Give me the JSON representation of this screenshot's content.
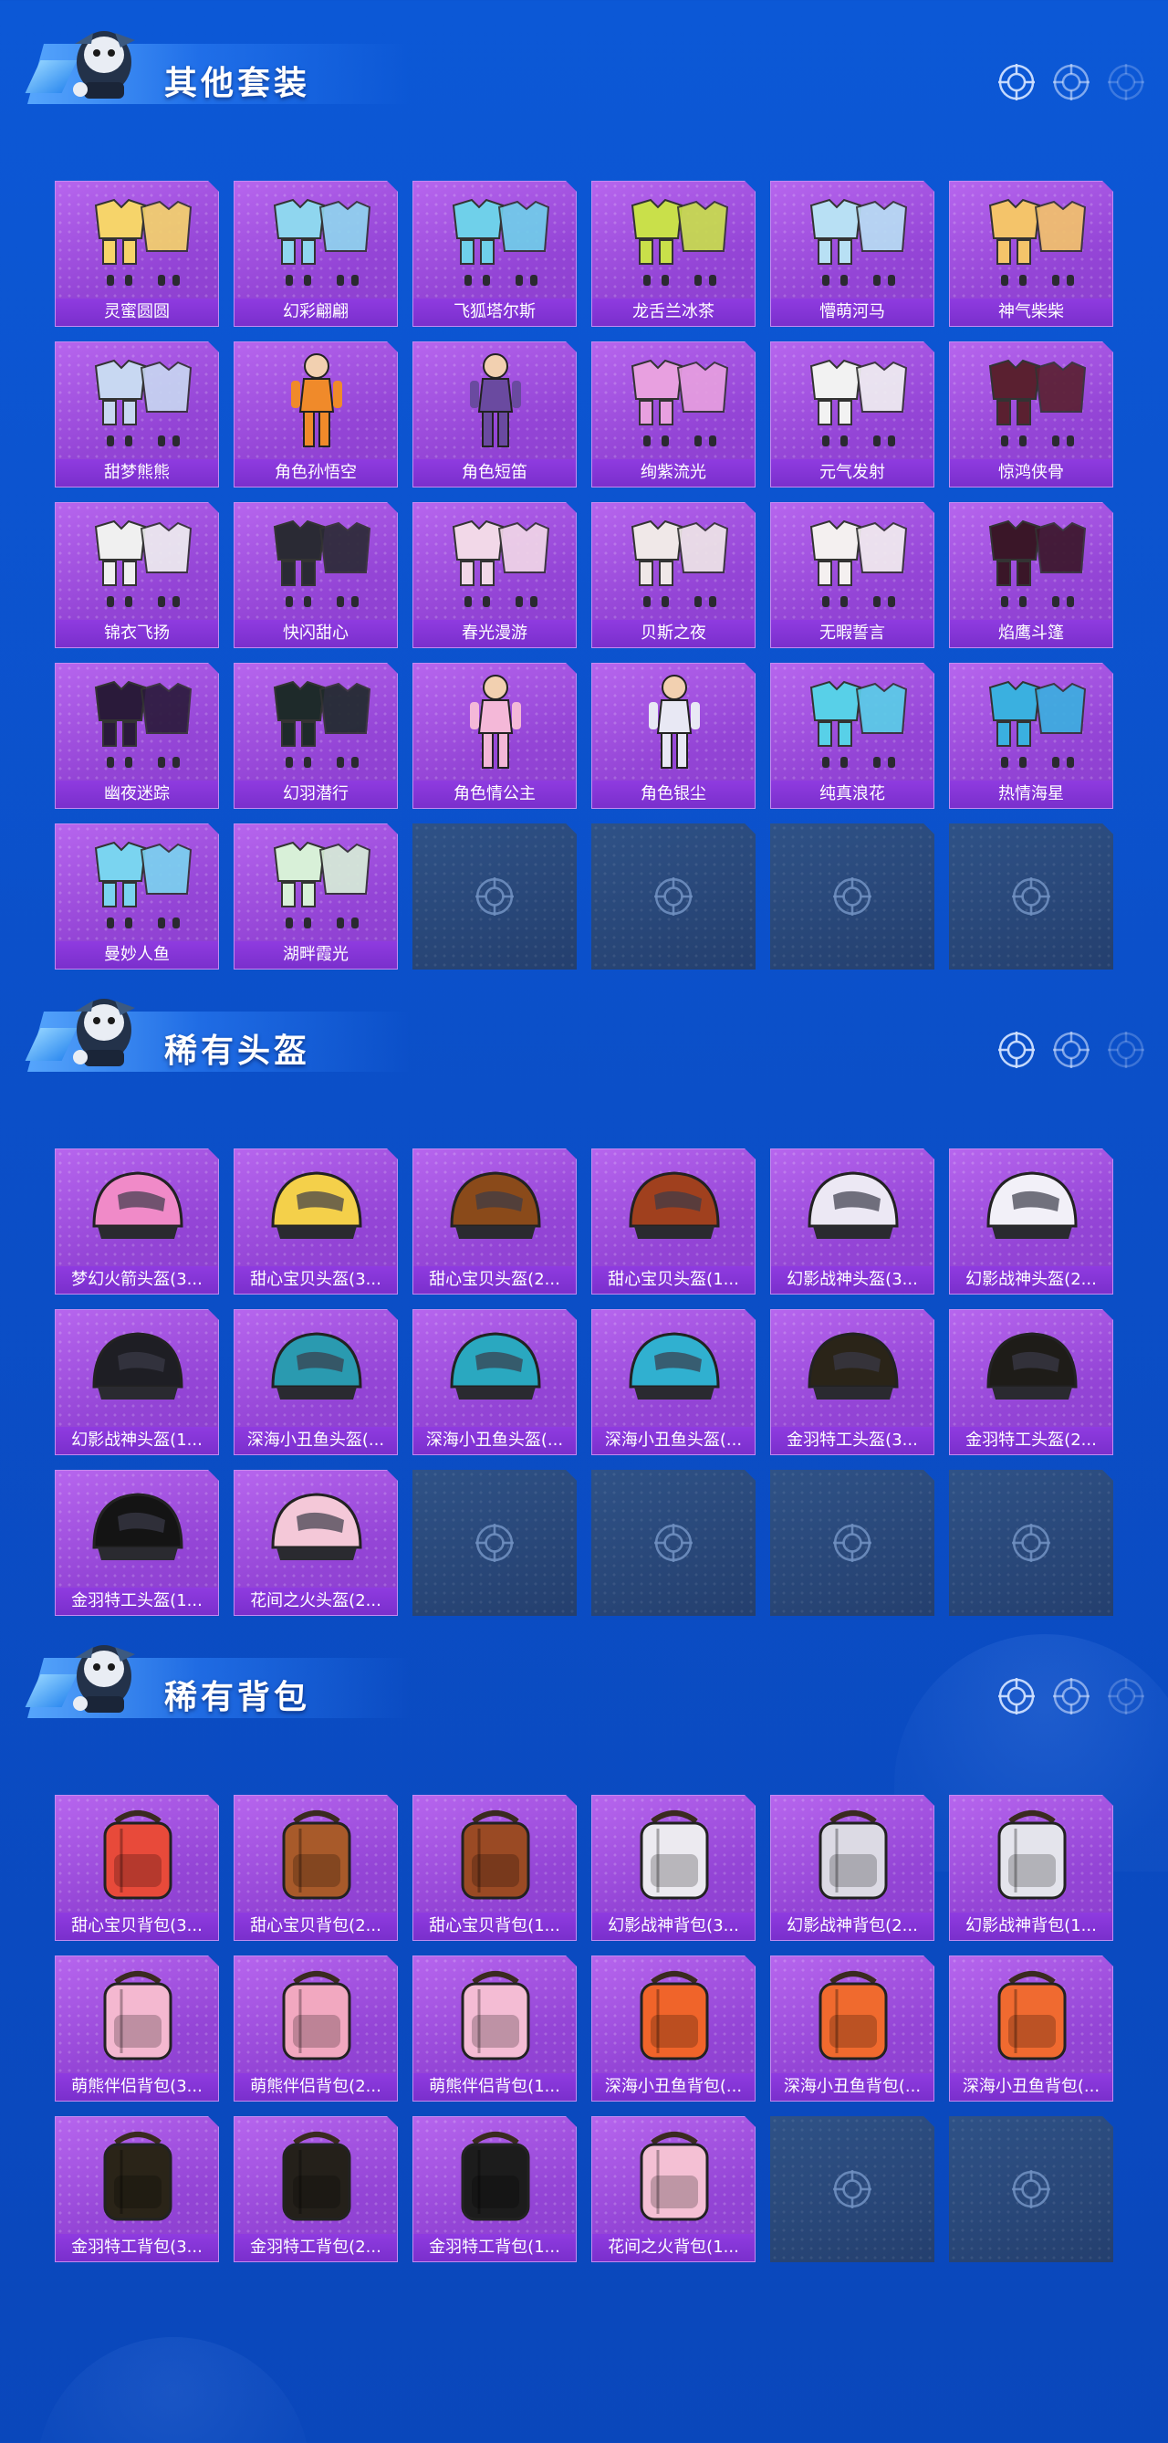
{
  "sections": [
    {
      "title": "其他套装",
      "items": [
        {
          "label": "灵蜜圆圆",
          "icon": "outfit-icon",
          "accent": "#f6d46a"
        },
        {
          "label": "幻彩翩翩",
          "icon": "outfit-icon",
          "accent": "#8fd6ef"
        },
        {
          "label": "飞狐塔尔斯",
          "icon": "outfit-icon",
          "accent": "#6fd0ea"
        },
        {
          "label": "龙舌兰冰茶",
          "icon": "outfit-icon",
          "accent": "#c9e04a"
        },
        {
          "label": "懵萌河马",
          "icon": "outfit-icon",
          "accent": "#b8e0f4"
        },
        {
          "label": "神气柴柴",
          "icon": "outfit-icon",
          "accent": "#f4c46a"
        },
        {
          "label": "甜梦熊熊",
          "icon": "outfit-icon",
          "accent": "#c8d8f2"
        },
        {
          "label": "角色孙悟空",
          "icon": "character-icon",
          "accent": "#f08a2a"
        },
        {
          "label": "角色短笛",
          "icon": "character-icon",
          "accent": "#6a4aa0"
        },
        {
          "label": "绚紫流光",
          "icon": "outfit-icon",
          "accent": "#e8a0e0"
        },
        {
          "label": "元气发射",
          "icon": "outfit-icon",
          "accent": "#f2f2f2"
        },
        {
          "label": "惊鸿侠骨",
          "icon": "outfit-icon",
          "accent": "#5a2030"
        },
        {
          "label": "锦衣飞扬",
          "icon": "outfit-icon",
          "accent": "#f0f0f0"
        },
        {
          "label": "快闪甜心",
          "icon": "outfit-icon",
          "accent": "#2a2a34"
        },
        {
          "label": "春光漫游",
          "icon": "outfit-icon",
          "accent": "#f2d8e8"
        },
        {
          "label": "贝斯之夜",
          "icon": "outfit-icon",
          "accent": "#f0e8e8"
        },
        {
          "label": "无暇誓言",
          "icon": "outfit-icon",
          "accent": "#f4f0f0"
        },
        {
          "label": "焰鹰斗篷",
          "icon": "outfit-icon",
          "accent": "#3a1628"
        },
        {
          "label": "幽夜迷踪",
          "icon": "outfit-icon",
          "accent": "#2a1a3a"
        },
        {
          "label": "幻羽潜行",
          "icon": "outfit-icon",
          "accent": "#1e2a2a"
        },
        {
          "label": "角色情公主",
          "icon": "character-icon",
          "accent": "#f4b8d8"
        },
        {
          "label": "角色银尘",
          "icon": "character-icon",
          "accent": "#e8e8f4"
        },
        {
          "label": "纯真浪花",
          "icon": "outfit-icon",
          "accent": "#58d0e8"
        },
        {
          "label": "热情海星",
          "icon": "outfit-icon",
          "accent": "#3ab0e0"
        },
        {
          "label": "曼妙人鱼",
          "icon": "outfit-icon",
          "accent": "#7ad4f0"
        },
        {
          "label": "湖畔霞光",
          "icon": "outfit-icon",
          "accent": "#d8f0d8"
        }
      ],
      "empty_slots": 4
    },
    {
      "title": "稀有头盔",
      "items": [
        {
          "label": "梦幻火箭头盔(3...",
          "icon": "helmet-icon",
          "accent": "#f08ac8"
        },
        {
          "label": "甜心宝贝头盔(3...",
          "icon": "helmet-icon",
          "accent": "#f4d04a"
        },
        {
          "label": "甜心宝贝头盔(2...",
          "icon": "helmet-icon",
          "accent": "#8a4a1a"
        },
        {
          "label": "甜心宝贝头盔(1...",
          "icon": "helmet-icon",
          "accent": "#a0401e"
        },
        {
          "label": "幻影战神头盔(3...",
          "icon": "helmet-icon",
          "accent": "#ece8f4"
        },
        {
          "label": "幻影战神头盔(2...",
          "icon": "helmet-icon",
          "accent": "#f2f0f8"
        },
        {
          "label": "幻影战神头盔(1...",
          "icon": "helmet-icon",
          "accent": "#1e1e24"
        },
        {
          "label": "深海小丑鱼头盔(...",
          "icon": "helmet-icon",
          "accent": "#2a9ab0"
        },
        {
          "label": "深海小丑鱼头盔(...",
          "icon": "helmet-icon",
          "accent": "#2aa8c0"
        },
        {
          "label": "深海小丑鱼头盔(...",
          "icon": "helmet-icon",
          "accent": "#30b0d0"
        },
        {
          "label": "金羽特工头盔(3...",
          "icon": "helmet-icon",
          "accent": "#2a2418"
        },
        {
          "label": "金羽特工头盔(2...",
          "icon": "helmet-icon",
          "accent": "#1e1c18"
        },
        {
          "label": "金羽特工头盔(1...",
          "icon": "helmet-icon",
          "accent": "#141414"
        },
        {
          "label": "花间之火头盔(2...",
          "icon": "helmet-icon",
          "accent": "#f4c8d8"
        }
      ],
      "empty_slots": 4
    },
    {
      "title": "稀有背包",
      "items": [
        {
          "label": "甜心宝贝背包(3...",
          "icon": "backpack-icon",
          "accent": "#e84a3a"
        },
        {
          "label": "甜心宝贝背包(2...",
          "icon": "backpack-icon",
          "accent": "#a85a2a"
        },
        {
          "label": "甜心宝贝背包(1...",
          "icon": "backpack-icon",
          "accent": "#9a4a24"
        },
        {
          "label": "幻影战神背包(3...",
          "icon": "backpack-icon",
          "accent": "#eceaf0"
        },
        {
          "label": "幻影战神背包(2...",
          "icon": "backpack-icon",
          "accent": "#dcdae4"
        },
        {
          "label": "幻影战神背包(1...",
          "icon": "backpack-icon",
          "accent": "#e4e4ec"
        },
        {
          "label": "萌熊伴侣背包(3...",
          "icon": "backpack-icon",
          "accent": "#f4b8d0"
        },
        {
          "label": "萌熊伴侣背包(2...",
          "icon": "backpack-icon",
          "accent": "#f2a8c0"
        },
        {
          "label": "萌熊伴侣背包(1...",
          "icon": "backpack-icon",
          "accent": "#f4bcd4"
        },
        {
          "label": "深海小丑鱼背包(...",
          "icon": "backpack-icon",
          "accent": "#f0642a"
        },
        {
          "label": "深海小丑鱼背包(...",
          "icon": "backpack-icon",
          "accent": "#f06a2e"
        },
        {
          "label": "深海小丑鱼背包(...",
          "icon": "backpack-icon",
          "accent": "#f06a30"
        },
        {
          "label": "金羽特工背包(3...",
          "icon": "backpack-icon",
          "accent": "#2a2418"
        },
        {
          "label": "金羽特工背包(2...",
          "icon": "backpack-icon",
          "accent": "#24201a"
        },
        {
          "label": "金羽特工背包(1...",
          "icon": "backpack-icon",
          "accent": "#1c1c1c"
        },
        {
          "label": "花间之火背包(1...",
          "icon": "backpack-icon",
          "accent": "#f4c0d4"
        }
      ],
      "empty_slots": 2
    }
  ]
}
